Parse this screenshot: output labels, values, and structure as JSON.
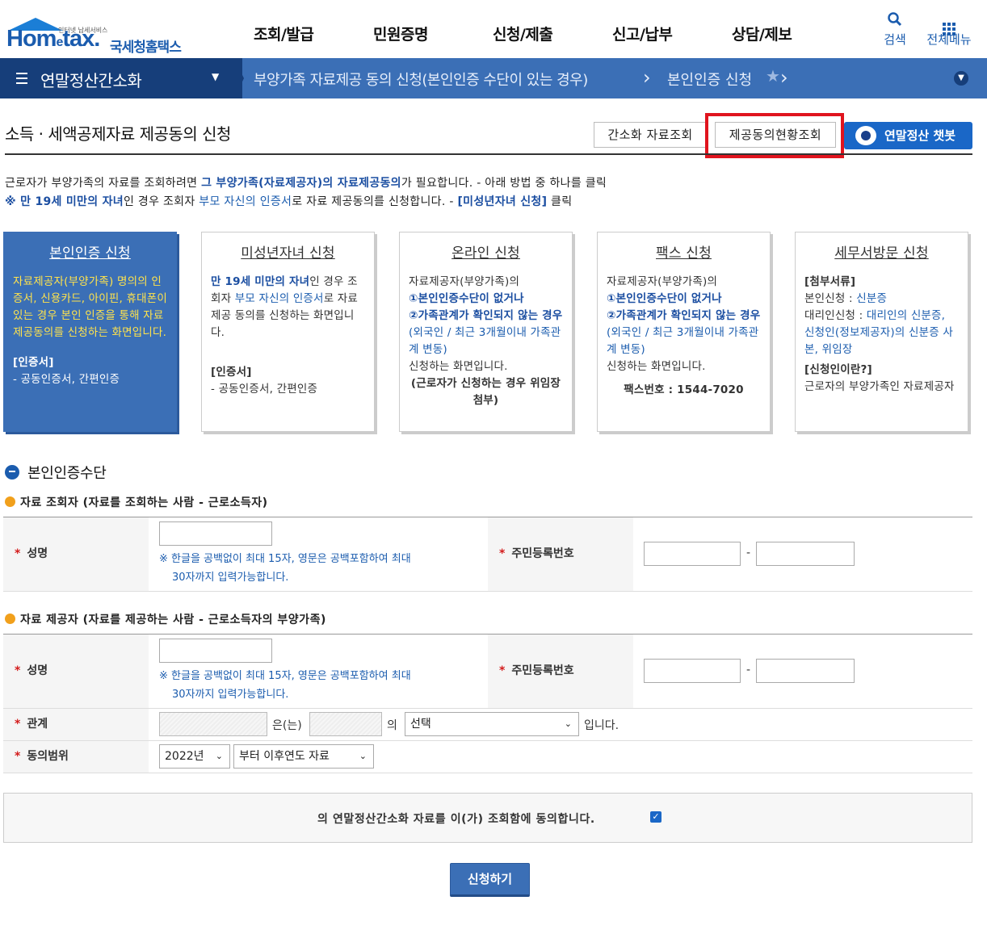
{
  "header": {
    "logo_small": "인터넷 납세서비스",
    "logo_home": "Hom",
    "logo_e": "e",
    "logo_tax": "tax.",
    "logo_kr": "국세청홈택스",
    "nav": [
      "조회/발급",
      "민원증명",
      "신청/제출",
      "신고/납부",
      "상담/제보"
    ],
    "search_label": "검색",
    "menu_label": "전체메뉴"
  },
  "breadcrumb": {
    "section": "연말정산간소화",
    "page": "부양가족 자료제공 동의 신청(본인인증 수단이 있는 경우)",
    "sub": "본인인증 신청"
  },
  "title": {
    "text": "소득 · 세액공제자료 제공동의 신청",
    "btn_lookup": "간소화 자료조회",
    "btn_status": "제공동의현황조회",
    "btn_chatbot": "연말정산 챗봇"
  },
  "intro": {
    "l1_a": "근로자가 부양가족의 자료를 조회하려면 ",
    "l1_b": "그 부양가족(자료제공자)의 자료제공동의",
    "l1_c": "가 필요합니다. - 아래 방법 중 하나를 클릭",
    "l2_a": "※ 만 19세 미만의 자녀",
    "l2_b": "인 경우 조회자 ",
    "l2_c": "부모 자신의 인증서",
    "l2_d": "로 자료 제공동의를 신청합니다. - ",
    "l2_e": "[미성년자녀 신청]",
    "l2_f": " 클릭"
  },
  "cards": [
    {
      "title": "본인인증 신청",
      "body": "자료제공자(부양가족) 명의의 인증서, 신용카드, 아이핀, 휴대폰이 있는 경우 본인 인증을 통해 자료제공동의를 신청하는 화면입니다.",
      "tag": "[인증서]",
      "list": "- 공동인증서, 간편인증"
    },
    {
      "title": "미성년자녀 신청",
      "body_a": "만 19세 미만의 자녀",
      "body_b": "인 경우 조회자 ",
      "body_c": "부모 자신의 인증서",
      "body_d": "로 자료 제공 동의를 신청하는 화면입니다.",
      "tag": "[인증서]",
      "list": "- 공동인증서, 간편인증"
    },
    {
      "title": "온라인 신청",
      "body_a": "자료제공자(부양가족)의",
      "body_b": "①본인인증수단이 없거나",
      "body_c": "②가족관계가 확인되지 않는 경우",
      "body_d": "(외국인 / 최근 3개월이내 가족관계 변동)",
      "body_e": "신청하는 화면입니다.",
      "body_f": "(근로자가 신청하는 경우 위임장 첨부)"
    },
    {
      "title": "팩스 신청",
      "body_a": "자료제공자(부양가족)의",
      "body_b": "①본인인증수단이 없거나",
      "body_c": "②가족관계가 확인되지 않는 경우",
      "body_d": "(외국인 / 최근 3개월이내 가족관계 변동)",
      "body_e": "신청하는 화면입니다.",
      "fax": "팩스번호 : 1544-7020"
    },
    {
      "title": "세무서방문 신청",
      "tag1": "[첨부서류]",
      "line1_a": "본인신청 : ",
      "line1_b": "신분증",
      "line2_a": "대리인신청 : ",
      "line2_b": "대리인의 신분증, 신청인(정보제공자)의 신분증 사본, 위임장",
      "tag2": "[신청인이란?]",
      "line3": "근로자의 부양가족인 자료제공자"
    }
  ],
  "section": {
    "title": "본인인증수단",
    "viewer": "자료 조회자 (자료를 조회하는 사람 - 근로소득자)",
    "provider": "자료 제공자 (자료를 제공하는 사람 - 근로소득자의 부양가족)"
  },
  "form": {
    "req_mark": "*",
    "name_label": "성명",
    "rrn_label": "주민등록번호",
    "note_a": "※ 한글을 공백없이 최대 15자, 영문은 공백포함하여 최대",
    "note_b": "30자까지 입력가능합니다.",
    "dash": "-",
    "relation_label": "관계",
    "relation_eun": "은(는)",
    "relation_ui": "의",
    "relation_select": "선택",
    "relation_end": "입니다.",
    "scope_label": "동의범위",
    "scope_year": "2022년",
    "scope_range": "부터 이후연도 자료"
  },
  "agree": {
    "text": "의 연말정산간소화 자료를 이(가) 조회함에 동의합니다.",
    "checked": true
  },
  "submit": "신청하기",
  "colors": {
    "brand": "#1b5cae",
    "active_card": "#3b6fb6",
    "highlight_box": "#e0141e"
  }
}
